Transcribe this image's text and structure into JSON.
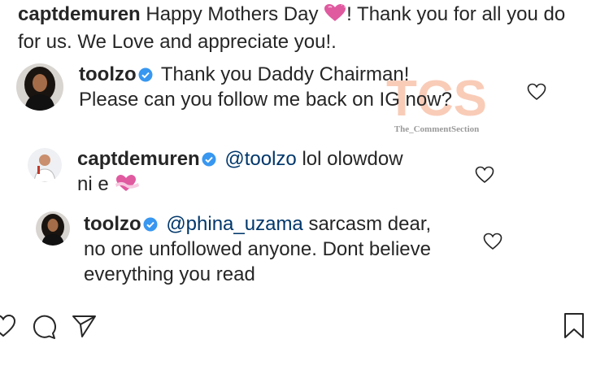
{
  "caption": {
    "username": "captdemuren",
    "text_before_emoji": "Happy Mothers Day ",
    "emoji": "pink-heart",
    "text_after_emoji": "! Thank you for all you do for us. We Love and appreciate you!."
  },
  "comments": [
    {
      "username": "toolzo",
      "verified": true,
      "mention": "",
      "text": "Thank you Daddy Chairman! Please can you follow me back on IG now?",
      "emoji": ""
    },
    {
      "username": "captdemuren",
      "verified": true,
      "mention": "@toolzo",
      "text": "lol olowdow ni e ",
      "emoji": "heart-with-ribbon"
    },
    {
      "username": "toolzo",
      "verified": true,
      "mention": "@phina_uzama",
      "text": "sarcasm dear, no one unfollowed anyone. Dont believe everything you read",
      "emoji": ""
    }
  ],
  "watermark": {
    "logo": "TCS",
    "caption": "The_CommentSection"
  },
  "actions": [
    "heart-icon",
    "comment-icon",
    "share-icon",
    "bookmark-icon"
  ],
  "colors": {
    "text": "#262626",
    "mention": "#00376b",
    "verified": "#3897f0",
    "heart_emoji": "#e05aa0"
  }
}
